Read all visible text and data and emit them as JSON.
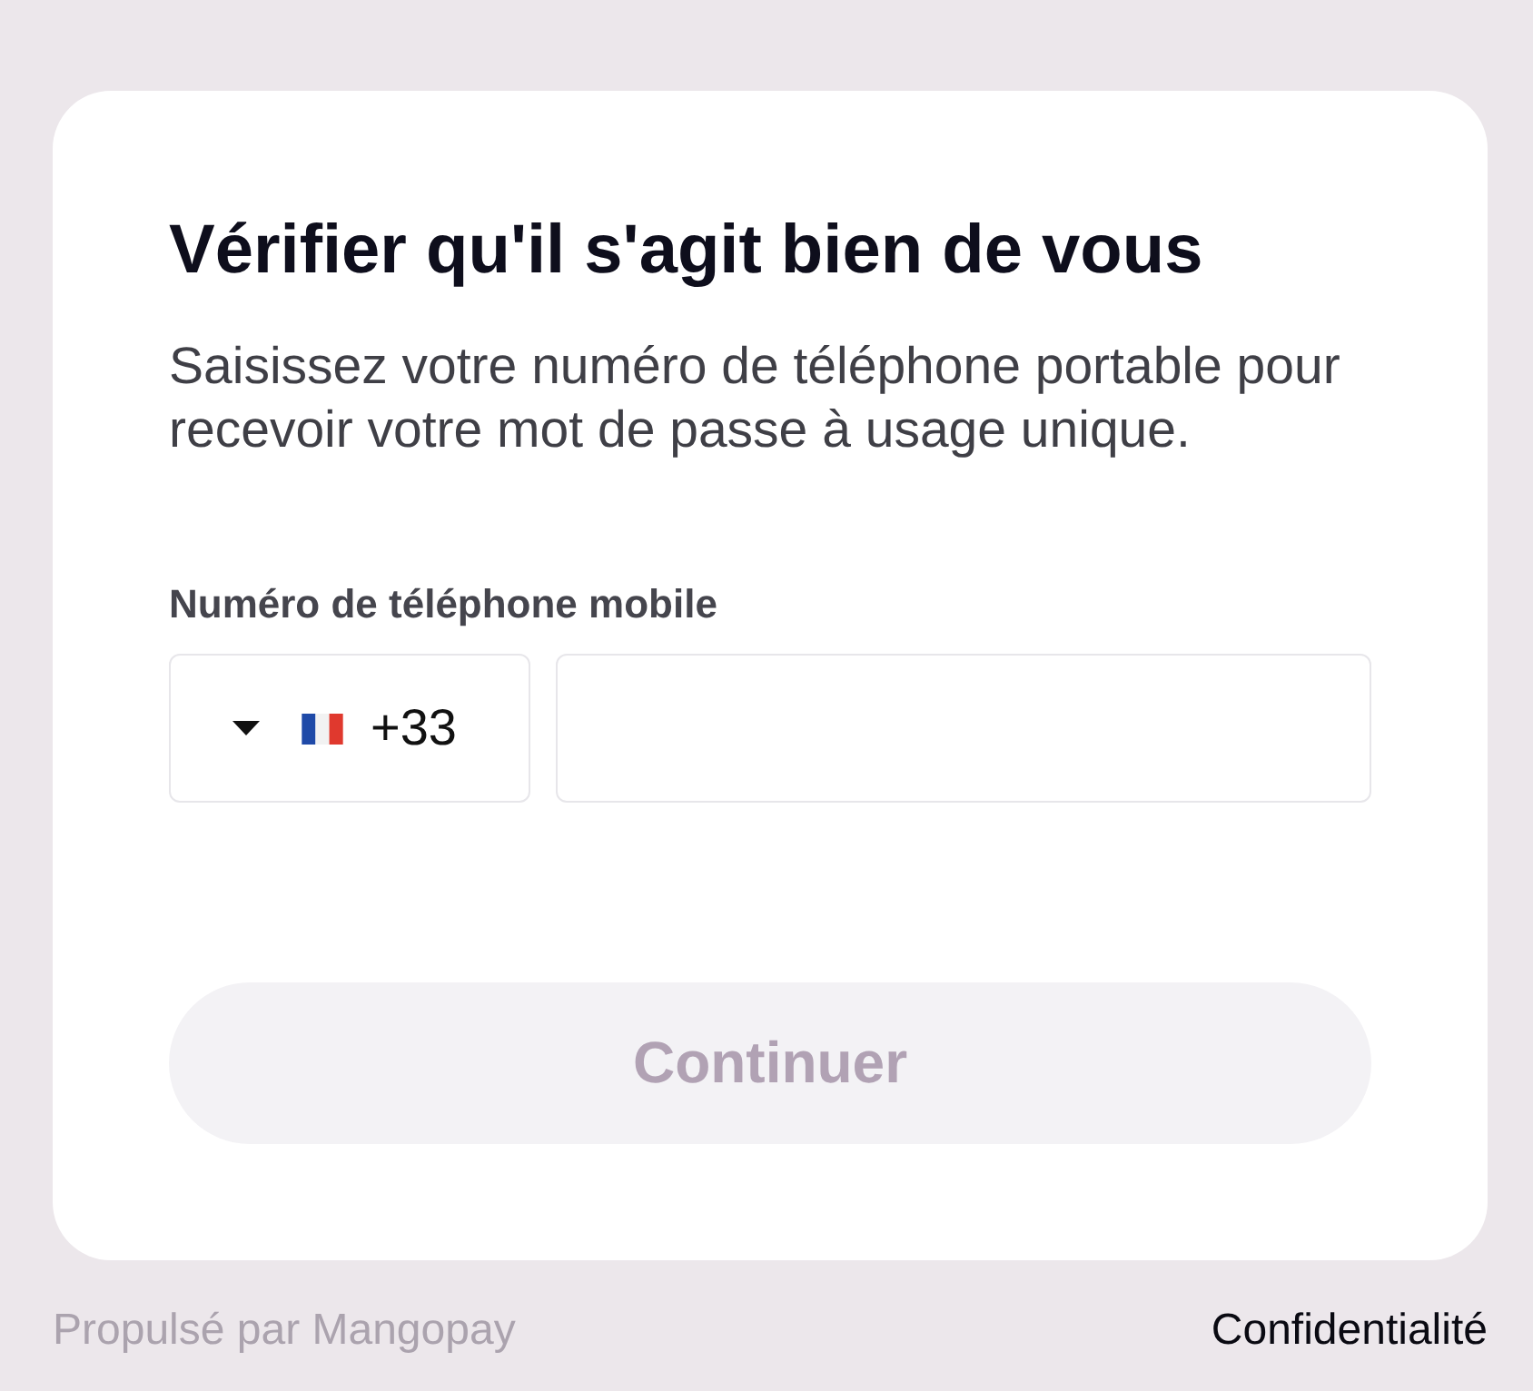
{
  "card": {
    "title": "Vérifier qu'il s'agit bien de vous",
    "description": "Saisissez votre numéro de téléphone portable pour recevoir votre mot de passe à usage unique.",
    "phone": {
      "label": "Numéro de téléphone mobile",
      "country_code": "+33"
    },
    "button": {
      "label": "Continuer",
      "disabled": true
    }
  },
  "footer": {
    "powered_by": "Propulsé par Mangopay",
    "privacy_link": "Confidentialité"
  }
}
